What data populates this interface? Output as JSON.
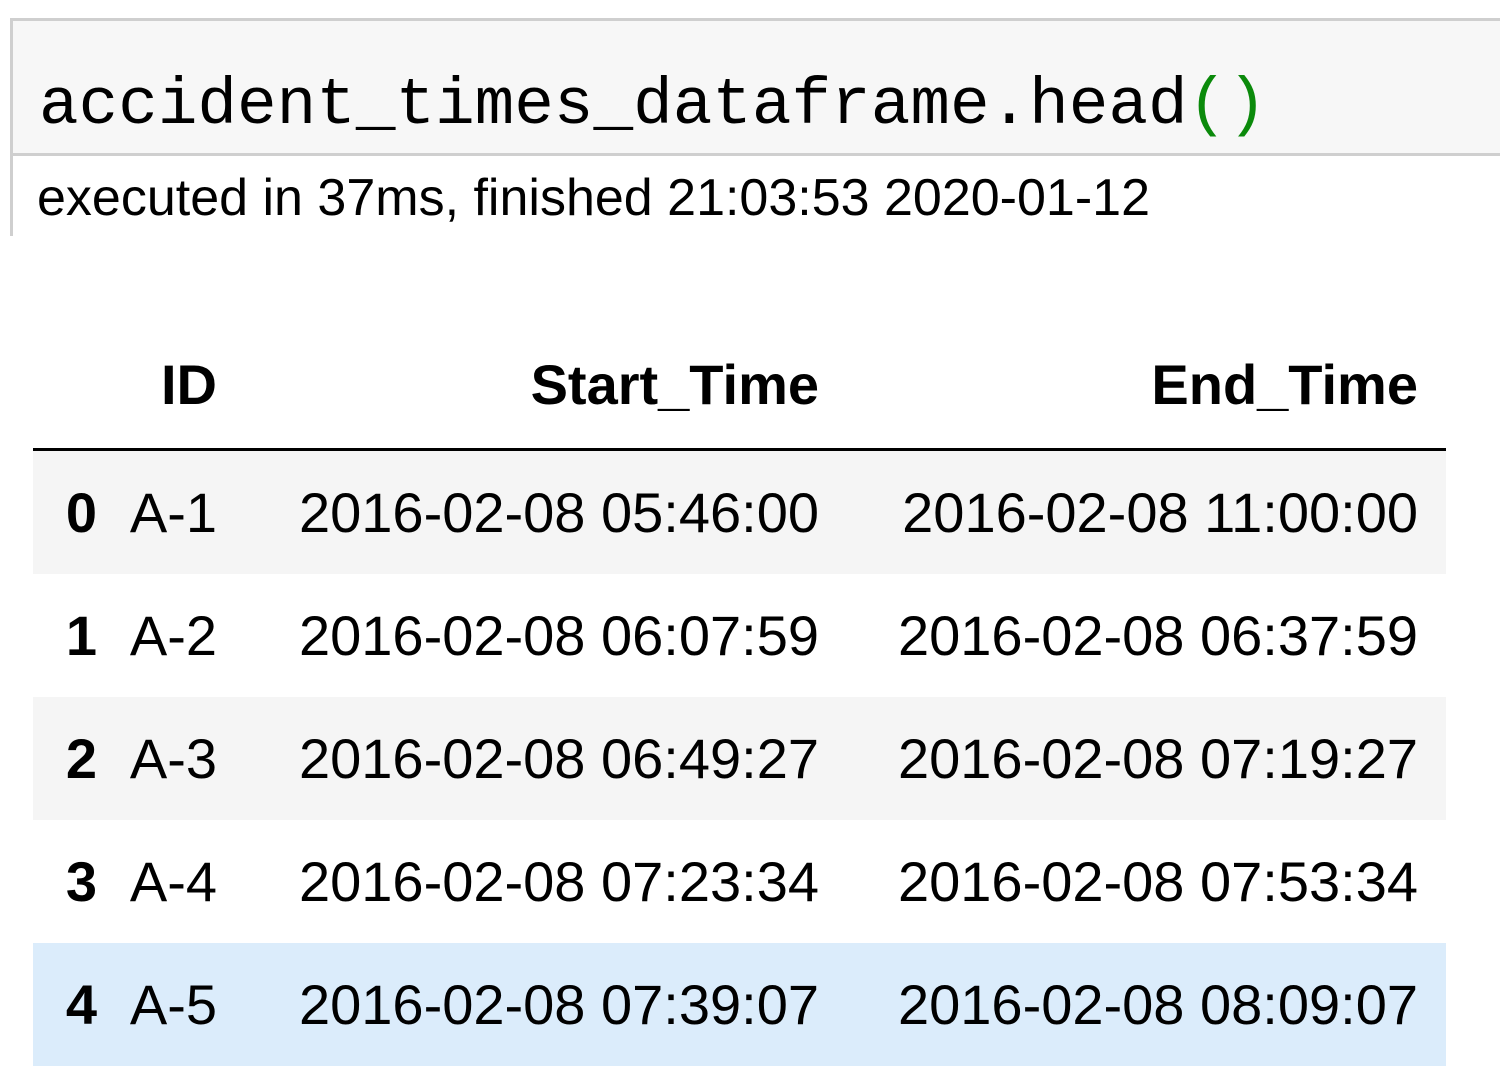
{
  "input_cell": {
    "code_main": "accident_times_dataframe.head",
    "code_parens": "()",
    "execution_info": "executed in 37ms, finished 21:03:53 2020-01-12"
  },
  "dataframe": {
    "columns": {
      "index": "",
      "id": "ID",
      "start_time": "Start_Time",
      "end_time": "End_Time"
    },
    "rows": [
      {
        "index": "0",
        "id": "A-1",
        "start_time": "2016-02-08 05:46:00",
        "end_time": "2016-02-08 11:00:00"
      },
      {
        "index": "1",
        "id": "A-2",
        "start_time": "2016-02-08 06:07:59",
        "end_time": "2016-02-08 06:37:59"
      },
      {
        "index": "2",
        "id": "A-3",
        "start_time": "2016-02-08 06:49:27",
        "end_time": "2016-02-08 07:19:27"
      },
      {
        "index": "3",
        "id": "A-4",
        "start_time": "2016-02-08 07:23:34",
        "end_time": "2016-02-08 07:53:34"
      },
      {
        "index": "4",
        "id": "A-5",
        "start_time": "2016-02-08 07:39:07",
        "end_time": "2016-02-08 08:09:07"
      }
    ]
  },
  "colors": {
    "paren_green": "#0b8a0b",
    "row_stripe": "#f5f5f5",
    "row_hover": "#dbecfb",
    "cell_border": "#cfcfcf"
  }
}
